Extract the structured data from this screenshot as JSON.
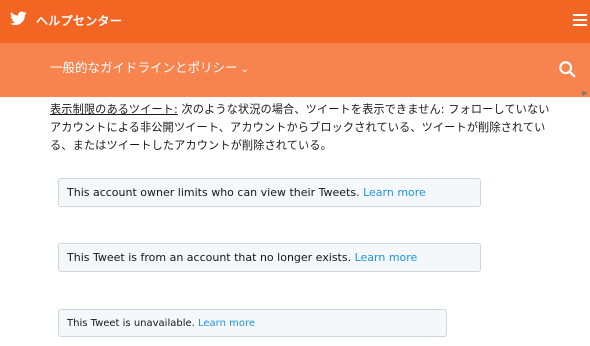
{
  "header": {
    "title": "ヘルプセンター",
    "logo_icon": "twitter-bird-icon",
    "menu_icon": "hamburger-menu-icon",
    "bg_color": "#f26522"
  },
  "subnav": {
    "label": "一般的なガイドラインとポリシー",
    "chevron": "⌄",
    "search_icon": "search-icon",
    "bg_color": "#f7844f"
  },
  "content": {
    "term": "表示制限のあるツイート:",
    "text": " 次のような状況の場合、ツイートを表示できません: フォローしていないアカウントによる非公開ツイート、アカウントからブロックされている、ツイートが削除されている、またはツイートしたアカウントが削除されている。"
  },
  "notices": [
    {
      "text": "This account owner limits who can view their Tweets. ",
      "link": "Learn more"
    },
    {
      "text": "This Tweet is from an account that no longer exists. ",
      "link": "Learn more"
    },
    {
      "text": "This Tweet is unavailable. ",
      "link": "Learn more"
    }
  ],
  "colors": {
    "link": "#1b95e0",
    "notice_bg": "#f5f8fa",
    "notice_border": "#ccd6dd"
  }
}
